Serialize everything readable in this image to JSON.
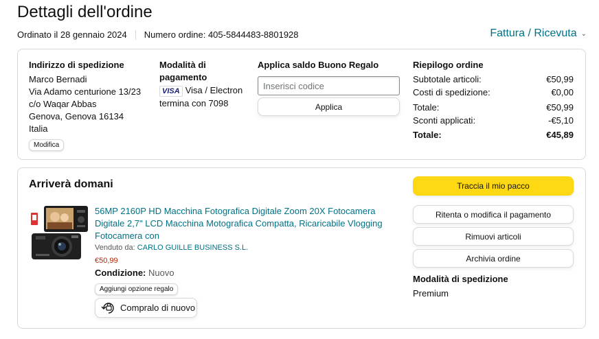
{
  "header": {
    "title": "Dettagli dell'ordine",
    "ordered_on": "Ordinato il 28 gennaio 2024",
    "order_number": "Numero ordine: 405-5844483-8801928",
    "invoice_link": "Fattura / Ricevuta"
  },
  "shipping_address": {
    "title": "Indirizzo di spedizione",
    "lines": [
      "Marco Bernadi",
      "Via Adamo centurione 13/23",
      "c/o Waqar Abbas",
      "Genova, Genova 16134",
      "Italia"
    ],
    "edit_button": "Modifica"
  },
  "payment": {
    "title": "Modalità di pagamento",
    "title_line1": "Modalità di",
    "title_line2": "pagamento",
    "card_brand": "VISA",
    "card_type": "Visa / Electron",
    "card_ending": "termina con 7098"
  },
  "gift_card": {
    "title": "Applica saldo Buono Regalo",
    "placeholder": "Inserisci codice",
    "apply_button": "Applica"
  },
  "summary": {
    "title": "Riepilogo ordine",
    "rows": [
      {
        "label": "Subtotale articoli:",
        "value": "€50,99"
      },
      {
        "label": "Costi di spedizione:",
        "value": "€0,00"
      },
      {
        "label": "Totale:",
        "value": "€50,99"
      },
      {
        "label": "Sconti applicati:",
        "value": "-€5,10"
      },
      {
        "label": "Totale:",
        "value": "€45,89"
      }
    ]
  },
  "shipment": {
    "status": "Arriverà domani",
    "product_title": "56MP 2160P HD Macchina Fotografica Digitale Zoom 20X Fotocamera Digitale 2,7\" LCD Macchina Motografica Compatta, Ricaricabile Vlogging Fotocamera con",
    "sold_by_label": "Venduto da:",
    "seller": "CARLO GUILLE BUSINESS S.L.",
    "price": "€50,99",
    "condition_label": "Condizione:",
    "condition_value": "Nuovo",
    "gift_option": "Aggiungi opzione regalo",
    "buy_again": "Compralo di nuovo",
    "actions": {
      "track": "Traccia il mio pacco",
      "retry_payment": "Ritenta o modifica il pagamento",
      "remove_items": "Rimuovi articoli",
      "archive": "Archivia ordine"
    },
    "shipping_method_title": "Modalità di spedizione",
    "shipping_method": "Premium"
  },
  "colors": {
    "link": "#007185",
    "price": "#b12704",
    "primary_button": "#ffd814",
    "border": "#d5d9d9"
  }
}
